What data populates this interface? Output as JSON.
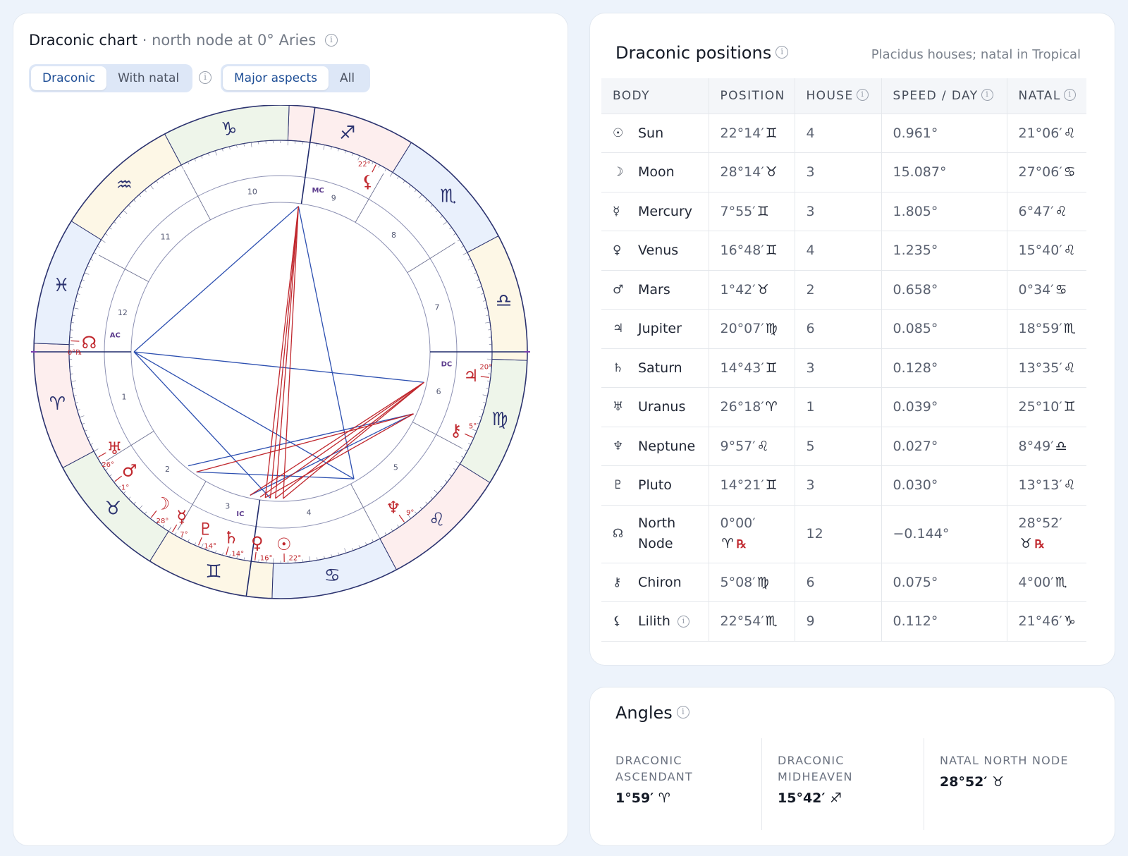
{
  "chart_panel": {
    "title": "Draconic chart",
    "subtitle": "· north node at 0° Aries",
    "view_toggle": {
      "options": [
        "Draconic",
        "With natal"
      ],
      "selected": "Draconic"
    },
    "aspect_toggle": {
      "options": [
        "Major aspects",
        "All"
      ],
      "selected": "Major aspects"
    },
    "wheel": {
      "signs": [
        "♈",
        "♉",
        "♊",
        "♋",
        "♌",
        "♍",
        "♎",
        "♏",
        "♐",
        "♑",
        "♒",
        "♓"
      ],
      "house_numbers": [
        "1",
        "2",
        "3",
        "4",
        "5",
        "6",
        "7",
        "8",
        "9",
        "10",
        "11",
        "12"
      ],
      "angle_labels": {
        "asc": "AC",
        "dc": "DC",
        "mc": "MC",
        "ic": "IC"
      },
      "planets": [
        {
          "glyph": "☊",
          "degree": "0°℞",
          "name": "north-node"
        },
        {
          "glyph": "♅",
          "degree": "26°",
          "name": "uranus"
        },
        {
          "glyph": "♂",
          "degree": "1°",
          "name": "mars"
        },
        {
          "glyph": "☽",
          "degree": "28°",
          "name": "moon"
        },
        {
          "glyph": "☿",
          "degree": "7°",
          "name": "mercury"
        },
        {
          "glyph": "♇",
          "degree": "14°",
          "name": "pluto"
        },
        {
          "glyph": "♄",
          "degree": "14°",
          "name": "saturn"
        },
        {
          "glyph": "♀",
          "degree": "16°",
          "name": "venus"
        },
        {
          "glyph": "☉",
          "degree": "22°",
          "name": "sun"
        },
        {
          "glyph": "♆",
          "degree": "9°",
          "name": "neptune"
        },
        {
          "glyph": "⚷",
          "degree": "5°",
          "name": "chiron"
        },
        {
          "glyph": "♃",
          "degree": "20°",
          "name": "jupiter"
        },
        {
          "glyph": "⚸",
          "degree": "22°",
          "name": "lilith"
        }
      ]
    }
  },
  "positions_panel": {
    "title": "Draconic positions",
    "note": "Placidus houses; natal in Tropical",
    "columns": [
      "BODY",
      "POSITION",
      "HOUSE",
      "SPEED / DAY",
      "NATAL"
    ],
    "rows": [
      {
        "glyph": "☉",
        "body": "Sun",
        "pos": "22°14′",
        "pos_sign": "♊",
        "house": "4",
        "speed": "0.961°",
        "natal": "21°06′",
        "natal_sign": "♌"
      },
      {
        "glyph": "☽",
        "body": "Moon",
        "pos": "28°14′",
        "pos_sign": "♉",
        "house": "3",
        "speed": "15.087°",
        "natal": "27°06′",
        "natal_sign": "♋"
      },
      {
        "glyph": "☿",
        "body": "Mercury",
        "pos": "7°55′",
        "pos_sign": "♊",
        "house": "3",
        "speed": "1.805°",
        "natal": "6°47′",
        "natal_sign": "♌"
      },
      {
        "glyph": "♀",
        "body": "Venus",
        "pos": "16°48′",
        "pos_sign": "♊",
        "house": "4",
        "speed": "1.235°",
        "natal": "15°40′",
        "natal_sign": "♌"
      },
      {
        "glyph": "♂",
        "body": "Mars",
        "pos": "1°42′",
        "pos_sign": "♉",
        "house": "2",
        "speed": "0.658°",
        "natal": "0°34′",
        "natal_sign": "♋"
      },
      {
        "glyph": "♃",
        "body": "Jupiter",
        "pos": "20°07′",
        "pos_sign": "♍",
        "house": "6",
        "speed": "0.085°",
        "natal": "18°59′",
        "natal_sign": "♏"
      },
      {
        "glyph": "♄",
        "body": "Saturn",
        "pos": "14°43′",
        "pos_sign": "♊",
        "house": "3",
        "speed": "0.128°",
        "natal": "13°35′",
        "natal_sign": "♌"
      },
      {
        "glyph": "♅",
        "body": "Uranus",
        "pos": "26°18′",
        "pos_sign": "♈",
        "house": "1",
        "speed": "0.039°",
        "natal": "25°10′",
        "natal_sign": "♊"
      },
      {
        "glyph": "♆",
        "body": "Neptune",
        "pos": "9°57′",
        "pos_sign": "♌",
        "house": "5",
        "speed": "0.027°",
        "natal": "8°49′",
        "natal_sign": "♎"
      },
      {
        "glyph": "♇",
        "body": "Pluto",
        "pos": "14°21′",
        "pos_sign": "♊",
        "house": "3",
        "speed": "0.030°",
        "natal": "13°13′",
        "natal_sign": "♌"
      },
      {
        "glyph": "☊",
        "body": "North Node",
        "pos": "0°00′",
        "pos_sign": "♈",
        "pos_retro": "℞",
        "house": "12",
        "speed": "−0.144°",
        "natal": "28°52′",
        "natal_sign": "♉",
        "natal_retro": "℞"
      },
      {
        "glyph": "⚷",
        "body": "Chiron",
        "pos": "5°08′",
        "pos_sign": "♍",
        "house": "6",
        "speed": "0.075°",
        "natal": "4°00′",
        "natal_sign": "♏"
      },
      {
        "glyph": "⚸",
        "body": "Lilith",
        "pos": "22°54′",
        "pos_sign": "♏",
        "house": "9",
        "speed": "0.112°",
        "natal": "21°46′",
        "natal_sign": "♑"
      }
    ]
  },
  "angles_panel": {
    "title": "Angles",
    "items": [
      {
        "label": "DRACONIC ASCENDANT",
        "value": "1°59′",
        "sign": "♈"
      },
      {
        "label": "DRACONIC MIDHEAVEN",
        "value": "15°42′",
        "sign": "♐"
      },
      {
        "label": "NATAL NORTH NODE",
        "value": "28°52′",
        "sign": "♉"
      }
    ]
  },
  "colors": {
    "accent": "#1e4e96",
    "aspect_red": "#c0272d",
    "aspect_blue": "#2c4fb0",
    "wheel_line": "#2d3470",
    "background": "#edf3fb"
  }
}
